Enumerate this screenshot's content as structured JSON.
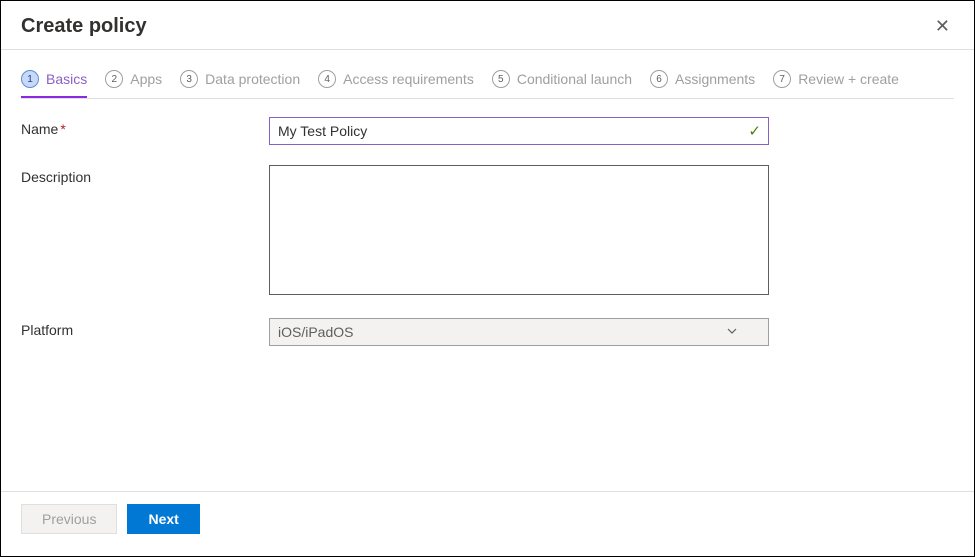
{
  "header": {
    "title": "Create policy"
  },
  "tabs": [
    {
      "num": "1",
      "label": "Basics"
    },
    {
      "num": "2",
      "label": "Apps"
    },
    {
      "num": "3",
      "label": "Data protection"
    },
    {
      "num": "4",
      "label": "Access requirements"
    },
    {
      "num": "5",
      "label": "Conditional launch"
    },
    {
      "num": "6",
      "label": "Assignments"
    },
    {
      "num": "7",
      "label": "Review + create"
    }
  ],
  "form": {
    "name_label": "Name",
    "name_value": "My Test Policy",
    "desc_label": "Description",
    "desc_value": "",
    "platform_label": "Platform",
    "platform_value": "iOS/iPadOS"
  },
  "footer": {
    "prev_label": "Previous",
    "next_label": "Next"
  }
}
